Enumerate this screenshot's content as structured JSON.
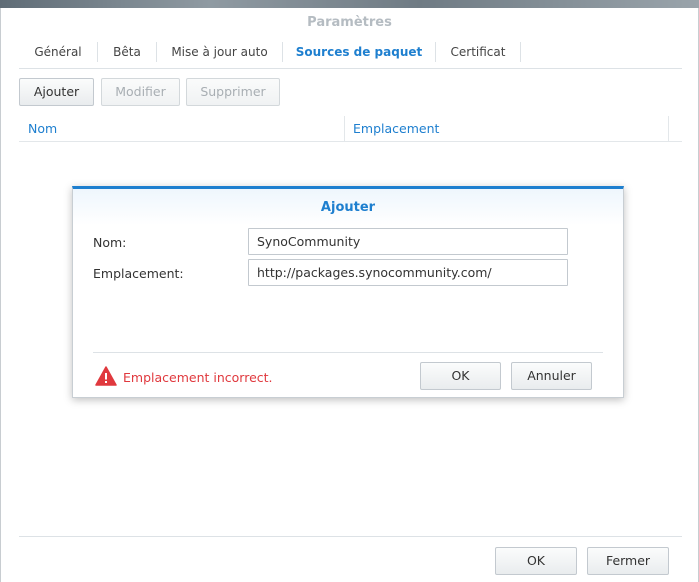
{
  "window": {
    "title": "Paramètres"
  },
  "tabs": [
    {
      "label": "Général"
    },
    {
      "label": "Bêta"
    },
    {
      "label": "Mise à jour auto"
    },
    {
      "label": "Sources de paquet",
      "active": true
    },
    {
      "label": "Certificat"
    }
  ],
  "toolbar": {
    "add_label": "Ajouter",
    "edit_label": "Modifier",
    "delete_label": "Supprimer"
  },
  "grid": {
    "columns": [
      "Nom",
      "Emplacement"
    ]
  },
  "dialog": {
    "title": "Ajouter",
    "name_label": "Nom:",
    "name_value": "SynoCommunity",
    "location_label": "Emplacement:",
    "location_value": "http://packages.synocommunity.com/",
    "error_text": "Emplacement incorrect.",
    "ok_label": "OK",
    "cancel_label": "Annuler"
  },
  "footer": {
    "ok_label": "OK",
    "close_label": "Fermer"
  },
  "colors": {
    "accent": "#1e7fcf",
    "error": "#e0393e",
    "warning_icon": "#e0393e"
  },
  "icons": {
    "error": "warning-triangle-icon"
  }
}
